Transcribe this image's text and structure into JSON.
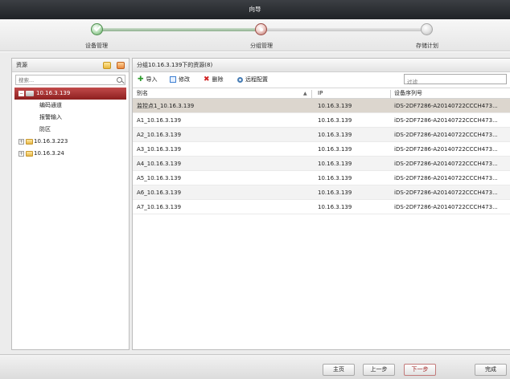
{
  "window": {
    "title": "向导"
  },
  "wizard": {
    "steps": [
      {
        "label": "设备管理",
        "state": "done"
      },
      {
        "label": "分组管理",
        "state": "current"
      },
      {
        "label": "存储计划",
        "state": "todo"
      }
    ]
  },
  "resources": {
    "title": "资源",
    "search_placeholder": "搜索...",
    "tree": {
      "selected": {
        "label": "10.16.3.139",
        "expander": "−",
        "children": [
          "编码通道",
          "报警输入",
          "防区"
        ]
      },
      "others": [
        {
          "label": "10.16.3.223",
          "expander": "+"
        },
        {
          "label": "10.16.3.24",
          "expander": "+"
        }
      ]
    }
  },
  "group": {
    "title": "分组10.16.3.139下的资源(8)",
    "toolbar": {
      "import": "导入",
      "modify": "修改",
      "delete": "删除",
      "remote_config": "远程配置"
    },
    "filter_placeholder": "过滤",
    "columns": {
      "alias": "别名",
      "sort_indicator": "▲",
      "ip": "IP",
      "serial": "设备序列号"
    },
    "rows": [
      {
        "alias": "监控点1_10.16.3.139",
        "ip": "10.16.3.139",
        "serial": "iDS-2DF7286-A20140722CCCH473..."
      },
      {
        "alias": "A1_10.16.3.139",
        "ip": "10.16.3.139",
        "serial": "iDS-2DF7286-A20140722CCCH473..."
      },
      {
        "alias": "A2_10.16.3.139",
        "ip": "10.16.3.139",
        "serial": "iDS-2DF7286-A20140722CCCH473..."
      },
      {
        "alias": "A3_10.16.3.139",
        "ip": "10.16.3.139",
        "serial": "iDS-2DF7286-A20140722CCCH473..."
      },
      {
        "alias": "A4_10.16.3.139",
        "ip": "10.16.3.139",
        "serial": "iDS-2DF7286-A20140722CCCH473..."
      },
      {
        "alias": "A5_10.16.3.139",
        "ip": "10.16.3.139",
        "serial": "iDS-2DF7286-A20140722CCCH473..."
      },
      {
        "alias": "A6_10.16.3.139",
        "ip": "10.16.3.139",
        "serial": "iDS-2DF7286-A20140722CCCH473..."
      },
      {
        "alias": "A7_10.16.3.139",
        "ip": "10.16.3.139",
        "serial": "iDS-2DF7286-A20140722CCCH473..."
      }
    ]
  },
  "footer": {
    "home": "主页",
    "prev": "上一步",
    "next": "下一步",
    "finish": "完成"
  }
}
